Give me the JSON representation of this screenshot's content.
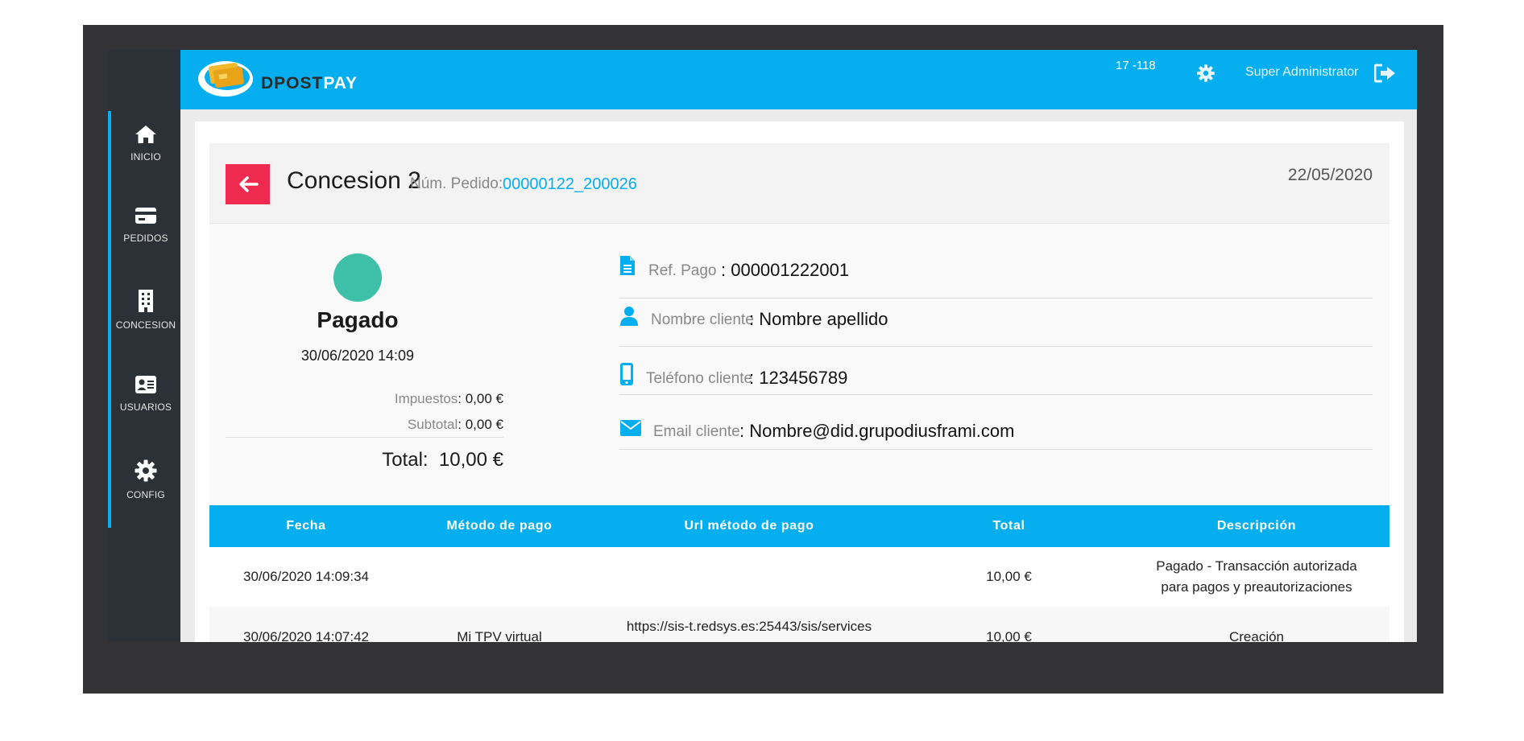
{
  "sidebar": {
    "items": [
      {
        "label": "INICIO",
        "icon": "home-icon"
      },
      {
        "label": "PEDIDOS",
        "icon": "credit-card-icon"
      },
      {
        "label": "CONCESION",
        "icon": "building-icon"
      },
      {
        "label": "USUARIOS",
        "icon": "id-card-icon"
      },
      {
        "label": "CONFIG",
        "icon": "gear-icon"
      }
    ]
  },
  "header": {
    "logo_dark": "DPOST",
    "logo_light": "PAY",
    "version": "17 -118",
    "user": "Super Administrator"
  },
  "order": {
    "title": "Concesion 2",
    "pedido_label": "Núm. Pedido:",
    "pedido_value": "00000122_200026",
    "date": "22/05/2020",
    "status": "Pagado",
    "status_date": "30/06/2020 14:09",
    "impuestos_label": "Impuestos",
    "impuestos_value": ": 0,00 €",
    "subtotal_label": "Subtotal",
    "subtotal_value": ": 0,00 €",
    "total_label": "Total:",
    "total_value": "10,00 €"
  },
  "info": {
    "ref_label": "Ref. Pago",
    "ref_value": ": 000001222001",
    "nombre_label": "Nombre cliente",
    "nombre_value": ":  Nombre apellido",
    "telefono_label": "Teléfono cliente",
    "telefono_value": ": 123456789",
    "email_label": "Email cliente",
    "email_value": ":  Nombre@did.grupodiusframi.com"
  },
  "table": {
    "headers": [
      "Fecha",
      "Método de pago",
      "Url método de pago",
      "Total",
      "Descripción"
    ],
    "rows": [
      {
        "fecha": "30/06/2020 14:09:34",
        "metodo": "",
        "url": "",
        "total": "10,00 €",
        "descripcion_l1": "Pagado - Transacción autorizada",
        "descripcion_l2": "para pagos y preautorizaciones"
      },
      {
        "fecha": "30/06/2020 14:07:42",
        "metodo": "Mi TPV virtual",
        "url": "https://sis-t.redsys.es:25443/sis/services",
        "total": "10,00 €",
        "descripcion_l1": "Creación",
        "descripcion_l2": ""
      }
    ]
  },
  "colors": {
    "accent": "#04aeef",
    "sidebar": "#2c3037",
    "back_button": "#ef2a51",
    "status_paid": "#3ebfa7"
  }
}
